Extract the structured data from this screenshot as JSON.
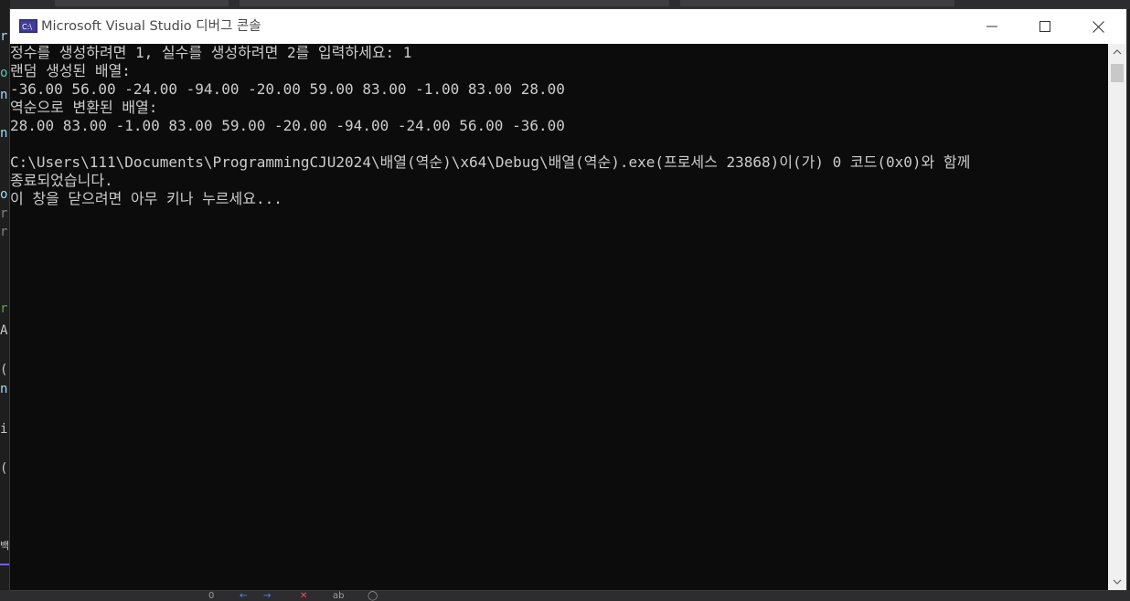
{
  "window": {
    "title": "Microsoft Visual Studio 디버그 콘솔",
    "icon_text": "C:\\"
  },
  "console": {
    "lines": [
      "정수를 생성하려면 1, 실수를 생성하려면 2를 입력하세요: 1",
      "랜덤 생성된 배열:",
      "-36.00 56.00 -24.00 -94.00 -20.00 59.00 83.00 -1.00 83.00 28.00",
      "역순으로 변환된 배열:",
      "28.00 83.00 -1.00 83.00 59.00 -20.00 -94.00 -24.00 56.00 -36.00",
      "",
      "C:\\Users\\111\\Documents\\ProgrammingCJU2024\\배열(역순)\\x64\\Debug\\배열(역순).exe(프로세스 23868)이(가) 0 코드(0x0)와 함께",
      "종료되었습니다.",
      "이 창을 닫으려면 아무 키나 누르세요..."
    ]
  },
  "ide_background": {
    "left_fragments": [
      "r",
      "o",
      "n",
      "n",
      "o",
      "r",
      "r",
      "r",
      "A",
      "(",
      "n",
      "i",
      "(",
      "백"
    ],
    "bottom_items": [
      "0",
      "←",
      "→",
      "✕",
      "ab"
    ]
  },
  "colors": {
    "console_bg": "#0c0c0c",
    "console_text": "#cccccc",
    "titlebar_bg": "#ffffff",
    "ide_bg": "#1e1e1e",
    "accent_purple": "#7160e8"
  },
  "icons": {
    "window_icon": "console-app-icon",
    "minimize": "minimize-icon",
    "maximize": "maximize-icon",
    "close": "close-icon",
    "scroll_up": "chevron-up-icon",
    "scroll_down": "chevron-down-icon"
  }
}
